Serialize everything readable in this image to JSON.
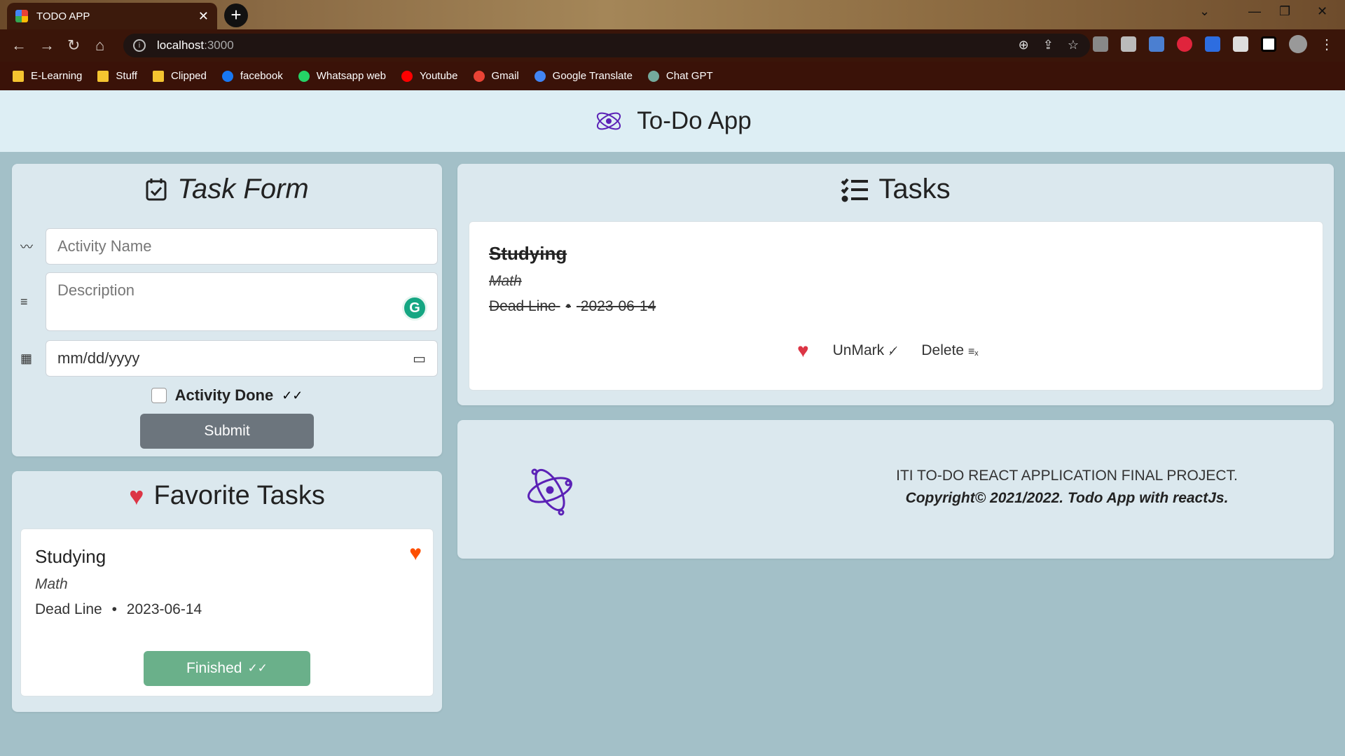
{
  "browser": {
    "tab_title": "TODO APP",
    "tab_close": "✕",
    "new_tab": "+",
    "url_host": "localhost",
    "url_port": ":3000",
    "bookmarks": [
      {
        "label": "E-Learning",
        "icon": "folder-icon"
      },
      {
        "label": "Stuff",
        "icon": "folder-icon"
      },
      {
        "label": "Clipped",
        "icon": "folder-icon"
      },
      {
        "label": "facebook",
        "icon": "facebook-icon"
      },
      {
        "label": "Whatsapp web",
        "icon": "whatsapp-icon"
      },
      {
        "label": "Youtube",
        "icon": "youtube-icon"
      },
      {
        "label": "Gmail",
        "icon": "gmail-icon"
      },
      {
        "label": "Google Translate",
        "icon": "translate-icon"
      },
      {
        "label": "Chat GPT",
        "icon": "chatgpt-icon"
      }
    ]
  },
  "header": {
    "title": "To-Do App",
    "icon": "atom-icon"
  },
  "task_form": {
    "title": "Task Form",
    "activity_placeholder": "Activity Name",
    "description_placeholder": "Description",
    "date_placeholder": "mm/dd/yyyy",
    "checkbox_label": "Activity Done",
    "submit_label": "Submit"
  },
  "favorites": {
    "title": "Favorite Tasks",
    "task": {
      "title": "Studying",
      "description": "Math",
      "deadline_label": "Dead Line",
      "separator": "•",
      "deadline": "2023-06-14",
      "button_label": "Finished"
    }
  },
  "tasks": {
    "title": "Tasks",
    "items": [
      {
        "title": "Studying",
        "description": "Math",
        "deadline_label": "Dead Line",
        "separator": "•",
        "deadline": "2023-06-14",
        "unmark_label": "UnMark",
        "delete_label": "Delete"
      }
    ]
  },
  "footer": {
    "line1": "ITI TO-DO REACT APPLICATION FINAL PROJECT.",
    "line2": "Copyright© 2021/2022. Todo App with reactJs."
  },
  "colors": {
    "accent_purple": "#5b21b6",
    "heart_red": "#dc3545",
    "heart_orange": "#fd4f00",
    "submit_gray": "#6c757d",
    "finished_green": "#6ab08a"
  }
}
